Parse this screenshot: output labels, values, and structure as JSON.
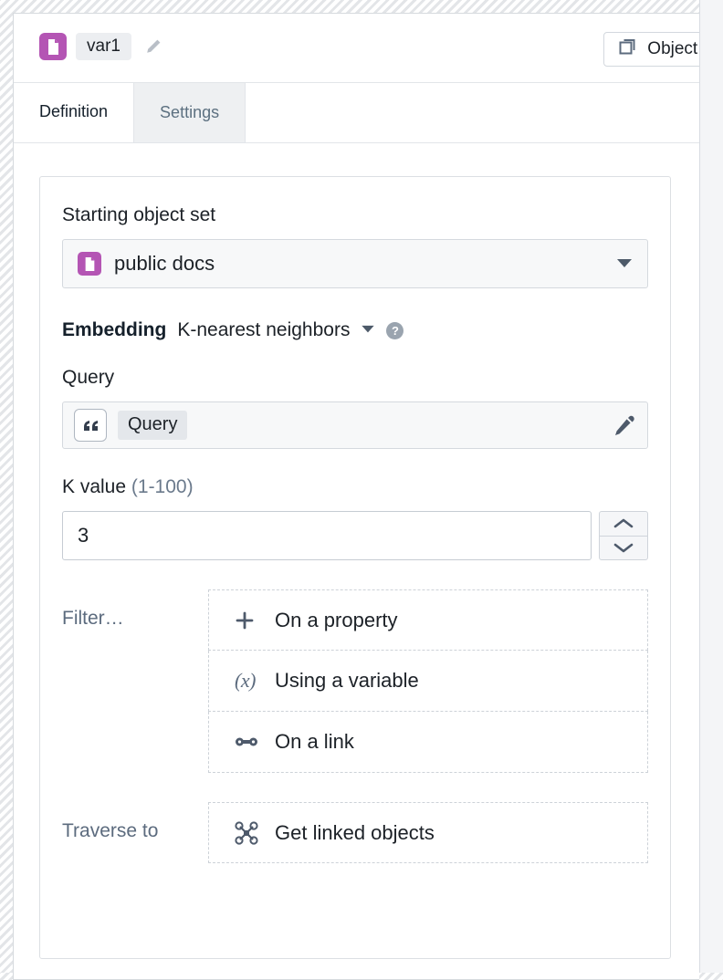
{
  "header": {
    "variable_icon": "document-icon",
    "variable_name": "var1",
    "edit_icon": "pencil-icon",
    "object_set_button": {
      "icon": "copy-objects-icon",
      "label": "Object s"
    }
  },
  "tabs": [
    {
      "id": "definition",
      "label": "Definition",
      "active": true
    },
    {
      "id": "settings",
      "label": "Settings",
      "active": false
    }
  ],
  "definition": {
    "starting_object_set": {
      "label": "Starting object set",
      "icon": "document-icon",
      "value": "public docs",
      "caret_icon": "caret-down-icon"
    },
    "embedding": {
      "label": "Embedding",
      "value": "K-nearest neighbors",
      "caret_icon": "caret-down-icon",
      "help_icon": "help-circle-icon",
      "help_glyph": "?"
    },
    "query": {
      "label": "Query",
      "quote_icon": "quote-icon",
      "chip_label": "Query",
      "edit_icon": "pencil-icon"
    },
    "k_value": {
      "label": "K value",
      "range_hint": "(1-100)",
      "value": "3",
      "increment_icon": "chevron-up-icon",
      "decrement_icon": "chevron-down-icon"
    },
    "filter": {
      "label": "Filter…",
      "options": [
        {
          "icon": "plus-icon",
          "label": "On a property"
        },
        {
          "icon": "variable-x-icon",
          "glyph": "(x)",
          "label": "Using a variable"
        },
        {
          "icon": "link-icon",
          "label": "On a link"
        }
      ]
    },
    "traverse": {
      "label": "Traverse to",
      "options": [
        {
          "icon": "graph-nodes-icon",
          "label": "Get linked objects"
        }
      ]
    }
  },
  "colors": {
    "accent_purple": "#b455b4",
    "text_primary": "#1c2127",
    "text_muted": "#5c6b7e",
    "border": "#d5d9de"
  }
}
